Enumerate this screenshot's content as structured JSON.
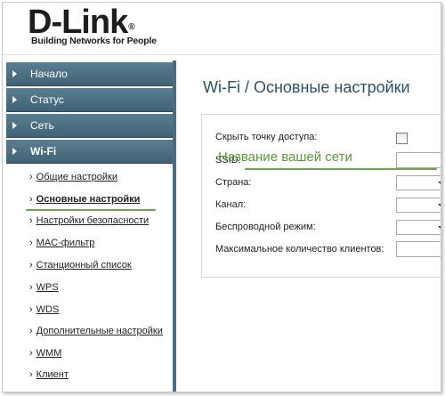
{
  "brand": {
    "logo_text": "D-Link",
    "logo_mark": "®",
    "tagline": "Building Networks for People"
  },
  "sidebar": {
    "sections": [
      {
        "label": "Начало"
      },
      {
        "label": "Статус"
      },
      {
        "label": "Сеть"
      },
      {
        "label": "Wi-Fi"
      }
    ],
    "bullet": "›",
    "subitems": [
      {
        "label": "Общие настройки"
      },
      {
        "label": "Основные настройки"
      },
      {
        "label": "Настройки безопасности"
      },
      {
        "label": "MAC-фильтр"
      },
      {
        "label": "Станционный список"
      },
      {
        "label": "WPS"
      },
      {
        "label": "WDS"
      },
      {
        "label": "Дополнительные настройки"
      },
      {
        "label": "WMM"
      },
      {
        "label": "Клиент"
      }
    ]
  },
  "main": {
    "title": "Wi-Fi  / Основные настройки",
    "fields": {
      "hide_ap": {
        "label": "Скрыть точку доступа:",
        "checked": false
      },
      "ssid": {
        "label": "SSID:",
        "value": ""
      },
      "country": {
        "label": "Страна:",
        "value": ""
      },
      "channel": {
        "label": "Канал:",
        "value": ""
      },
      "mode": {
        "label": "Беспроводной режим:",
        "value": ""
      },
      "max_clients": {
        "label": "Максимальное количество клиентов:",
        "value": ""
      }
    },
    "callout": "Название вашей сети"
  },
  "colors": {
    "nav_bg": "#4d7286",
    "accent_green": "#5a9a3f",
    "title_blue": "#2f4f6a"
  }
}
